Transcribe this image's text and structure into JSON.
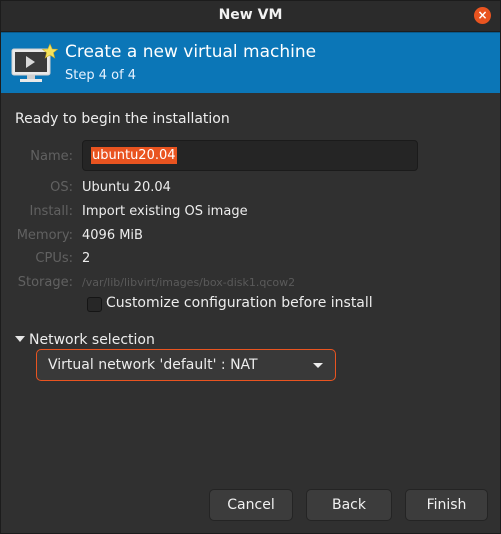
{
  "window": {
    "title": "New VM",
    "close_label": "×"
  },
  "banner": {
    "title": "Create a new virtual machine",
    "step": "Step 4 of 4",
    "icon": "vm-monitor-star-icon"
  },
  "summary": {
    "heading": "Ready to begin the installation",
    "fields": {
      "name_label": "Name:",
      "name_value": "ubuntu20.04",
      "os_label": "OS:",
      "os_value": "Ubuntu 20.04",
      "install_label": "Install:",
      "install_value": "Import existing OS image",
      "memory_label": "Memory:",
      "memory_value": "4096 MiB",
      "cpus_label": "CPUs:",
      "cpus_value": "2",
      "storage_label": "Storage:",
      "storage_value": "/var/lib/libvirt/images/box-disk1.qcow2"
    },
    "customize_label": "Customize configuration before install",
    "customize_checked": false
  },
  "network": {
    "section_label": "Network selection",
    "selected": "Virtual network 'default' : NAT"
  },
  "buttons": {
    "cancel": "Cancel",
    "back": "Back",
    "finish": "Finish"
  },
  "colors": {
    "accent": "#e95420",
    "banner": "#0b76b7"
  }
}
